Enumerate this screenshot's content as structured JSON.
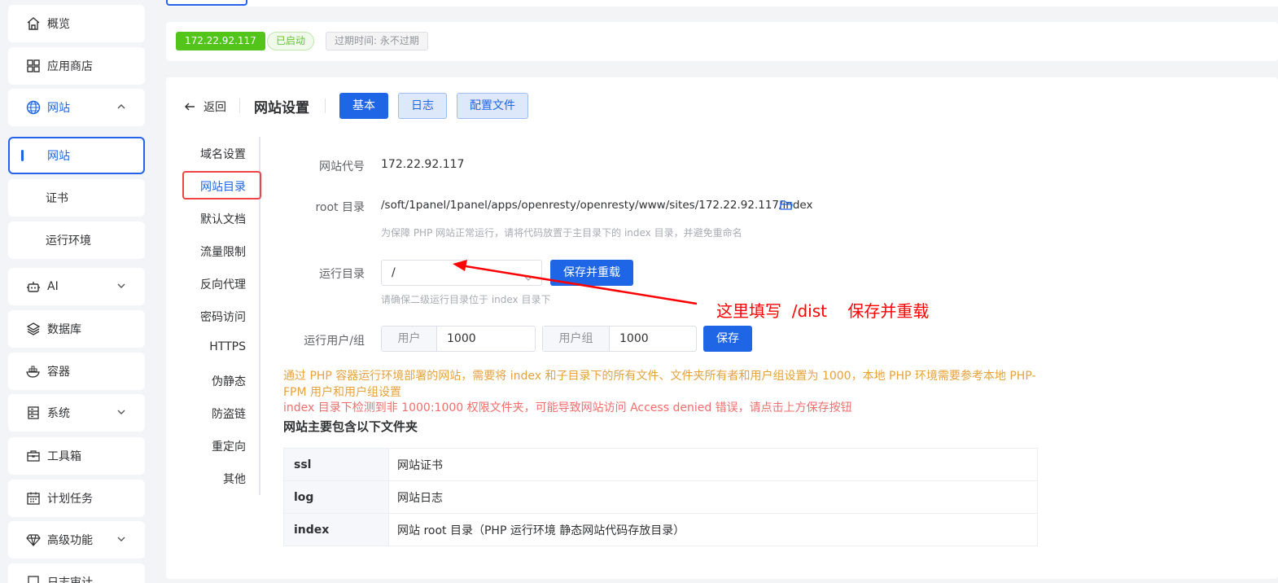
{
  "sidebar": {
    "items": [
      {
        "label": "概览",
        "icon": "home-icon"
      },
      {
        "label": "应用商店",
        "icon": "grid-icon"
      },
      {
        "label": "网站",
        "icon": "globe-icon",
        "expanded": true
      },
      {
        "label": "AI",
        "icon": "robot-icon"
      },
      {
        "label": "数据库",
        "icon": "layers-icon"
      },
      {
        "label": "容器",
        "icon": "docker-icon"
      },
      {
        "label": "系统",
        "icon": "server-icon"
      },
      {
        "label": "工具箱",
        "icon": "toolbox-icon"
      },
      {
        "label": "计划任务",
        "icon": "calendar-icon"
      },
      {
        "label": "高级功能",
        "icon": "diamond-icon"
      },
      {
        "label": "日志审计",
        "icon": "log-icon"
      }
    ],
    "subitems": [
      {
        "label": "网站",
        "active": true
      },
      {
        "label": "证书"
      },
      {
        "label": "运行环境"
      }
    ]
  },
  "status": {
    "ip": "172.22.92.117",
    "state": "已启动",
    "expire": "过期时间: 永不过期"
  },
  "header": {
    "back": "返回",
    "title": "网站设置",
    "tabs": [
      "基本",
      "日志",
      "配置文件"
    ]
  },
  "submenu": [
    "域名设置",
    "网站目录",
    "默认文档",
    "流量限制",
    "反向代理",
    "密码访问",
    "HTTPS",
    "伪静态",
    "防盗链",
    "重定向",
    "其他"
  ],
  "form": {
    "site_code_label": "网站代号",
    "site_code": "172.22.92.117",
    "root_label": "root 目录",
    "root_path": "/soft/1panel/1panel/apps/openresty/openresty/www/sites/172.22.92.117/index",
    "root_hint": "为保障 PHP 网站正常运行，请将代码放置于主目录下的 index 目录，并避免重命名",
    "run_dir_label": "运行目录",
    "run_dir": "/",
    "save_reload": "保存并重载",
    "run_dir_hint": "请确保二级运行目录位于 index 目录下",
    "run_user_label": "运行用户/组",
    "user_prefix": "用户",
    "user_value": "1000",
    "group_prefix": "用户组",
    "group_value": "1000",
    "save": "保存"
  },
  "warnings": {
    "orange": "通过 PHP 容器运行环境部署的网站，需要将 index 和子目录下的所有文件、文件夹所有者和用户组设置为 1000，本地 PHP 环境需要参考本地 PHP-FPM 用户和用户组设置",
    "red": "index 目录下检测到非 1000:1000 权限文件夹，可能导致网站访问 Access denied 错误，请点击上方保存按钮"
  },
  "folders": {
    "title": "网站主要包含以下文件夹",
    "rows": [
      {
        "name": "ssl",
        "desc": "网站证书"
      },
      {
        "name": "log",
        "desc": "网站日志"
      },
      {
        "name": "index",
        "desc": "网站 root 目录（PHP 运行环境 静态网站代码存放目录）"
      }
    ]
  },
  "annotation": "这里填写  /dist    保存并重载",
  "colors": {
    "primary": "#1f66e6",
    "success": "#52c41a",
    "warning": "#e6a23c",
    "danger": "#f56c6c",
    "annotation": "#ff0000"
  }
}
